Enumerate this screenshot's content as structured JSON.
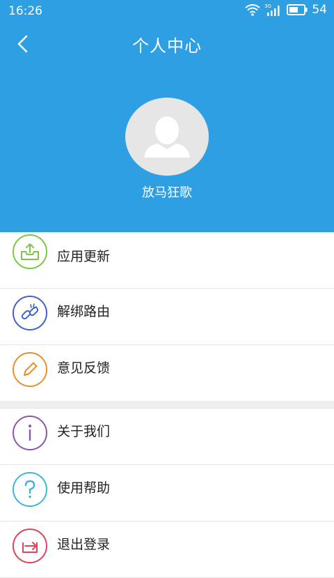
{
  "status": {
    "time": "16:26",
    "network": "3G",
    "battery": "54"
  },
  "header": {
    "title": "个人中心",
    "username": "放马狂歌"
  },
  "menu": {
    "group1": [
      {
        "label": "应用更新",
        "icon": "upload-tray-icon",
        "color": "#7cc54b"
      },
      {
        "label": "解绑路由",
        "icon": "broken-link-icon",
        "color": "#3f62c9"
      },
      {
        "label": "意见反馈",
        "icon": "pencil-icon",
        "color": "#e8902b"
      }
    ],
    "group2": [
      {
        "label": "关于我们",
        "icon": "info-icon",
        "color": "#8a57a8"
      },
      {
        "label": "使用帮助",
        "icon": "question-icon",
        "color": "#3bb6d9"
      },
      {
        "label": "退出登录",
        "icon": "logout-icon",
        "color": "#d9455b"
      }
    ]
  },
  "colors": {
    "header_bg": "#2f9fe3"
  }
}
